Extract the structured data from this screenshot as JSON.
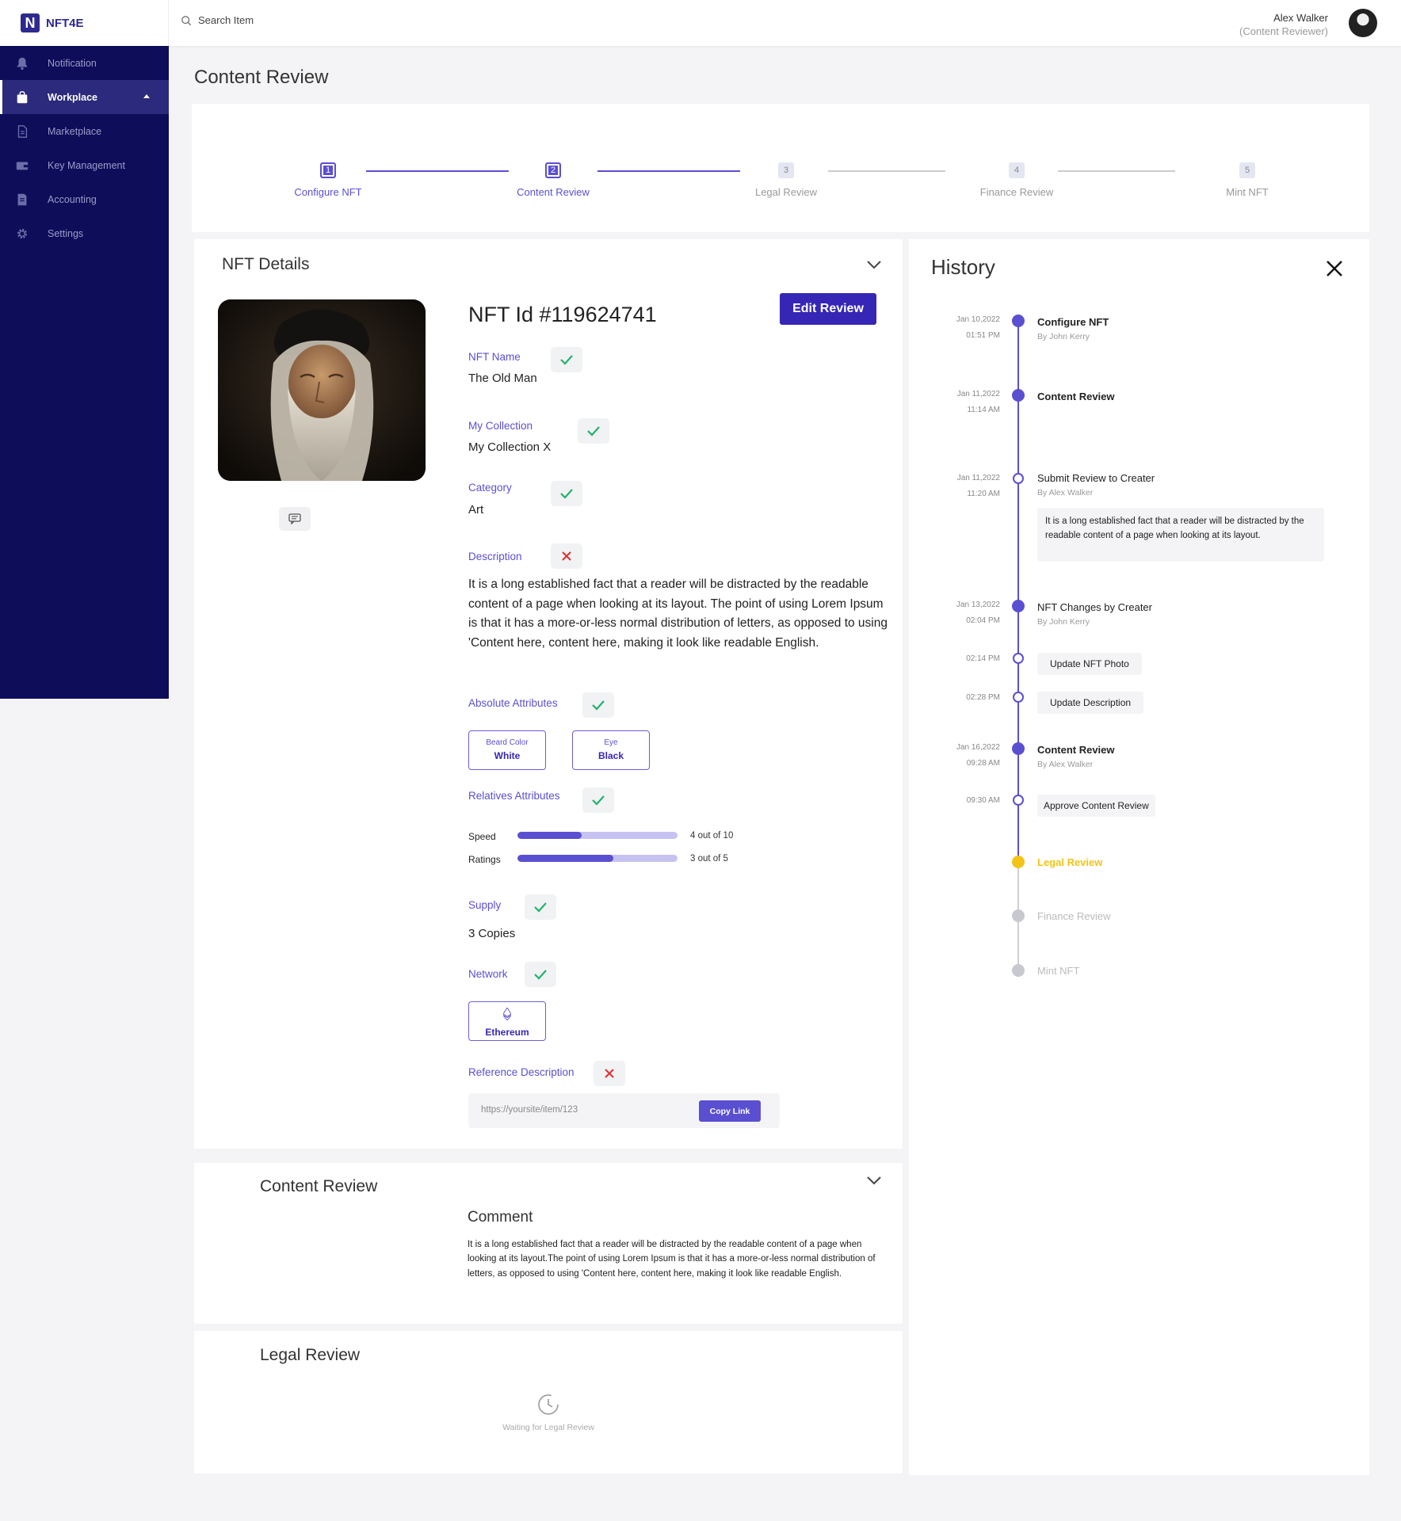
{
  "brand": {
    "logo_letter": "N",
    "name": "NFT4E"
  },
  "search": {
    "placeholder": "Search Item"
  },
  "user": {
    "name": "Alex Walker",
    "role": "(Content Reviewer)"
  },
  "sidebar": {
    "items": [
      {
        "label": "Notification",
        "icon": "bell-icon"
      },
      {
        "label": "Workplace",
        "icon": "bag-icon",
        "active": true
      },
      {
        "label": "Marketplace",
        "icon": "document-icon"
      },
      {
        "label": "Key Management",
        "icon": "wallet-icon"
      },
      {
        "label": "Accounting",
        "icon": "ledger-icon"
      },
      {
        "label": "Settings",
        "icon": "gear-icon"
      }
    ]
  },
  "page": {
    "title": "Content Review"
  },
  "stepper": {
    "steps": [
      {
        "num": "1",
        "label": "Configure NFT",
        "status": "done"
      },
      {
        "num": "2",
        "label": "Content Review",
        "status": "done"
      },
      {
        "num": "3",
        "label": "Legal Review",
        "status": "todo"
      },
      {
        "num": "4",
        "label": "Finance Review",
        "status": "todo"
      },
      {
        "num": "5",
        "label": "Mint NFT",
        "status": "todo"
      }
    ]
  },
  "nft": {
    "section_title": "NFT Details",
    "id_text": "NFT Id  #119624741",
    "edit_label": "Edit Review",
    "name_label": "NFT Name",
    "name_value": "The Old Man",
    "collection_label": "My Collection",
    "collection_value": "My Collection X",
    "category_label": "Category",
    "category_value": "Art",
    "description_label": "Description",
    "description_value": "It is a long established fact that a reader will be distracted by the readable content of a page when looking at its layout. The point of using Lorem Ipsum is that it has a more-or-less normal distribution of letters, as opposed to using 'Content here, content here, making it look like readable English.",
    "abs_label": "Absolute Attributes",
    "abs_attrs": [
      {
        "key": "Beard  Color",
        "value": "White"
      },
      {
        "key": "Eye",
        "value": "Black"
      }
    ],
    "rel_label": "Relatives Attributes",
    "rel_attrs": [
      {
        "label": "Speed",
        "value": 4,
        "max": 10,
        "text": "4 out of 10"
      },
      {
        "label": "Ratings",
        "value": 3,
        "max": 5,
        "text": "3 out of 5"
      }
    ],
    "supply_label": "Supply",
    "supply_value": "3 Copies",
    "network_label": "Network",
    "network_value": "Ethereum",
    "ref_label": "Reference Description",
    "ref_url": "https://yoursite/item/123",
    "copy_label": "Copy Link"
  },
  "content_review": {
    "title": "Content Review",
    "comment_title": "Comment",
    "comment": "It is a long established fact that a reader will be distracted by the readable content of a page when looking at its layout.The point of using Lorem Ipsum is that it has a more-or-less normal distribution of letters, as opposed to using 'Content here, content here, making it look like readable English."
  },
  "legal_review": {
    "title": "Legal Review",
    "waiting": "Waiting for Legal Review"
  },
  "history": {
    "title": "History",
    "events": [
      {
        "date": "Jan 10,2022",
        "time": "01:51 PM",
        "title": "Configure NFT",
        "by": "By John Kerry"
      },
      {
        "date": "Jan 11,2022",
        "time": "11:14 AM",
        "title": "Content Review"
      },
      {
        "date": "Jan 11,2022",
        "time": "11:20 AM",
        "title": "Submit Review to Creater",
        "by": "By Alex Walker",
        "note": "It is a long established fact that a reader will be distracted by the readable content of a page when looking at its layout."
      },
      {
        "date": "Jan 13,2022",
        "time": "02:04 PM",
        "title": "NFT Changes by Creater",
        "by": "By John Kerry"
      },
      {
        "time": "02:14 PM",
        "title": "Update NFT Photo"
      },
      {
        "time": "02:28 PM",
        "title": "Update Description"
      },
      {
        "date": "Jan 16,2022",
        "time": "09:28 AM",
        "title": "Content Review",
        "by": "By Alex Walker"
      },
      {
        "time": "09:30 AM",
        "title": "Approve Content Review"
      },
      {
        "title": "Legal Review"
      },
      {
        "title": "Finance Review"
      },
      {
        "title": "Mint NFT"
      }
    ]
  },
  "colors": {
    "sidebar": "#0e0d5a",
    "accent": "#5b4fd1",
    "button": "#3626b5",
    "pending": "#f2c417",
    "check": "#22b26e",
    "cross": "#e03131"
  }
}
